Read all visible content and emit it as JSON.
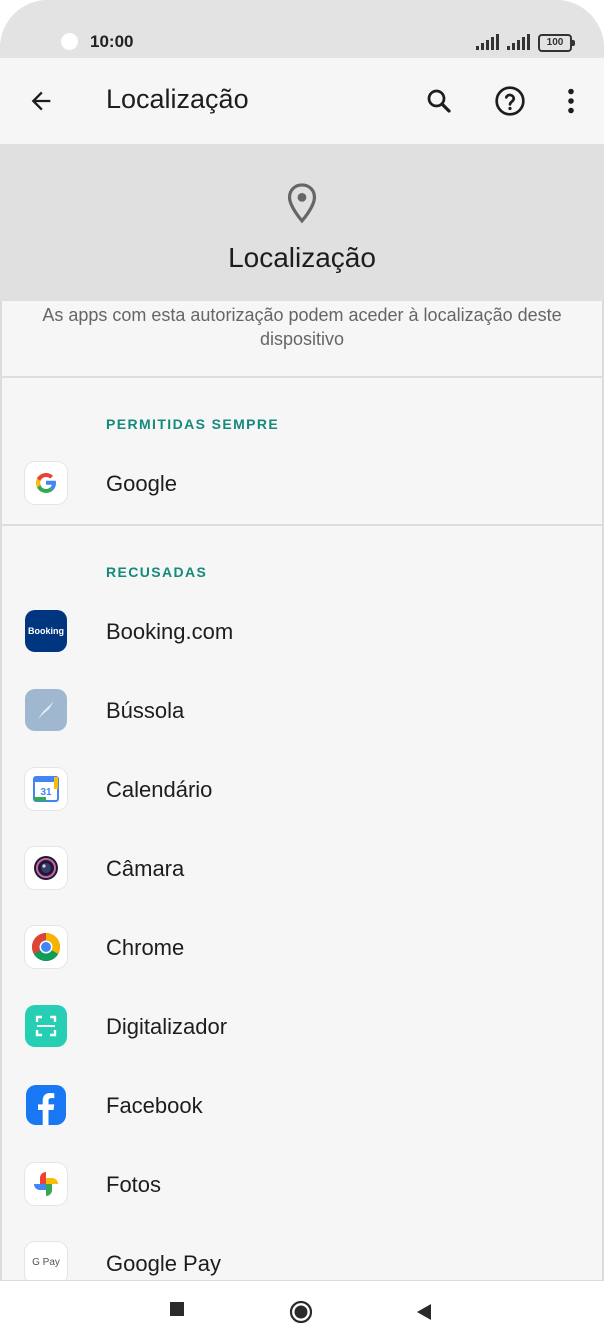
{
  "status": {
    "time": "10:00",
    "battery": "100"
  },
  "appbar": {
    "title": "Localização"
  },
  "header": {
    "title": "Localização",
    "description": "As apps com esta autorização podem aceder à localização deste dispositivo"
  },
  "sections": [
    {
      "title": "PERMITIDAS SEMPRE",
      "apps": [
        "Google"
      ]
    },
    {
      "title": "RECUSADAS",
      "apps": [
        "Booking.com",
        "Bússola",
        "Calendário",
        "Câmara",
        "Chrome",
        "Digitalizador",
        "Facebook",
        "Fotos",
        "Google Pay"
      ]
    }
  ],
  "icons": {
    "booking_text": "Booking",
    "calendar_day": "31",
    "gpay_text": "G Pay"
  },
  "colors": {
    "accent": "#15897a",
    "booking": "#003580",
    "facebook": "#1877f2"
  }
}
